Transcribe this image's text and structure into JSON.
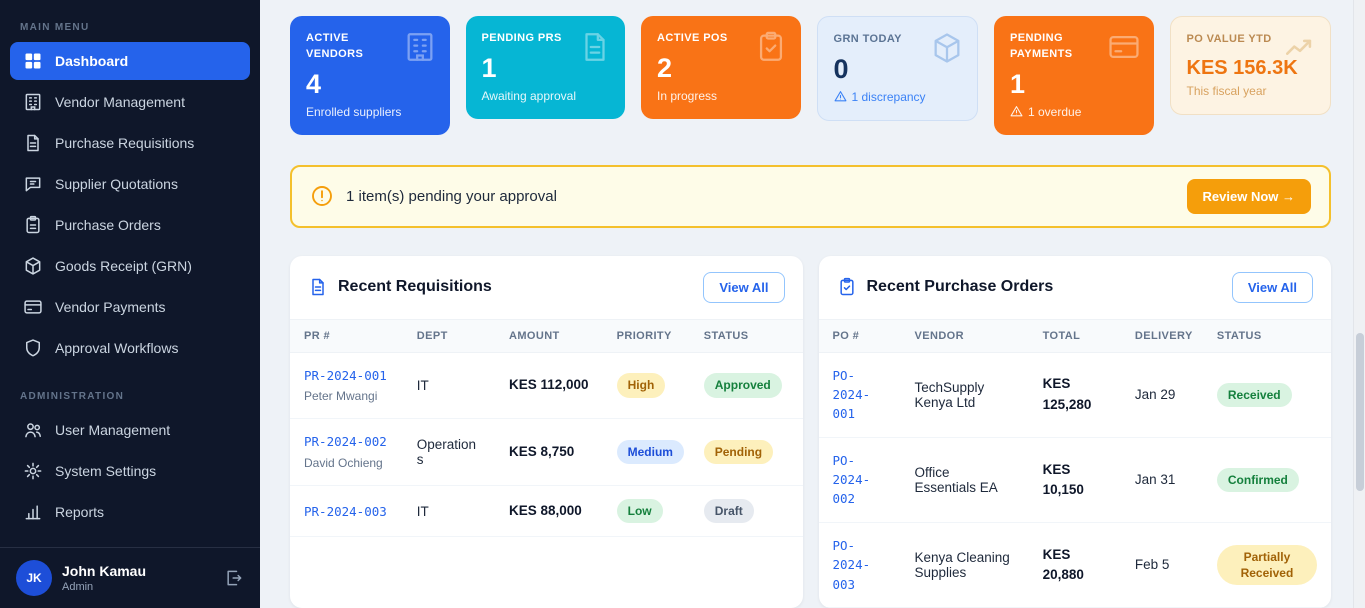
{
  "colors": {
    "accent_blue": "#2563eb",
    "accent_cyan": "#06b6d4",
    "accent_orange": "#f97316",
    "amber": "#f59e0b",
    "sidebar_bg": "#0f172a"
  },
  "sidebar": {
    "main_menu_label": "MAIN MENU",
    "items": [
      {
        "label": "Dashboard",
        "icon": "grid-icon",
        "active": true
      },
      {
        "label": "Vendor Management",
        "icon": "building-icon"
      },
      {
        "label": "Purchase Requisitions",
        "icon": "document-icon"
      },
      {
        "label": "Supplier Quotations",
        "icon": "chat-icon"
      },
      {
        "label": "Purchase Orders",
        "icon": "clipboard-icon"
      },
      {
        "label": "Goods Receipt (GRN)",
        "icon": "box-icon"
      },
      {
        "label": "Vendor Payments",
        "icon": "credit-card-icon"
      },
      {
        "label": "Approval Workflows",
        "icon": "shield-icon"
      }
    ],
    "admin_label": "ADMINISTRATION",
    "admin_items": [
      {
        "label": "User Management",
        "icon": "users-icon"
      },
      {
        "label": "System Settings",
        "icon": "gear-icon"
      },
      {
        "label": "Reports",
        "icon": "bar-chart-icon"
      }
    ],
    "user": {
      "initials": "JK",
      "name": "John Kamau",
      "role": "Admin"
    }
  },
  "stats": [
    {
      "title": "ACTIVE VENDORS",
      "value": "4",
      "subtitle": "Enrolled suppliers",
      "icon": "building-icon",
      "theme": "blue"
    },
    {
      "title": "PENDING PRS",
      "value": "1",
      "subtitle": "Awaiting approval",
      "icon": "document-icon",
      "theme": "cyan"
    },
    {
      "title": "ACTIVE POS",
      "value": "2",
      "subtitle": "In progress",
      "icon": "clipboard-check-icon",
      "theme": "orange"
    },
    {
      "title": "GRN TODAY",
      "value": "0",
      "subtitle": "1 discrepancy",
      "warning": true,
      "icon": "box-icon",
      "theme": "light-blue"
    },
    {
      "title": "PENDING PAYMENTS",
      "value": "1",
      "subtitle": "1 overdue",
      "warning": true,
      "icon": "credit-card-icon",
      "theme": "orange"
    },
    {
      "title": "PO VALUE YTD",
      "value": "KES 156.3K",
      "subtitle": "This fiscal year",
      "icon": "trending-icon",
      "theme": "cream"
    }
  ],
  "alert": {
    "message": "1 item(s) pending your approval",
    "button_label": "Review Now →"
  },
  "requisitions": {
    "title": "Recent Requisitions",
    "view_all_label": "View All",
    "columns": [
      "PR #",
      "DEPT",
      "AMOUNT",
      "PRIORITY",
      "STATUS"
    ],
    "rows": [
      {
        "id": "PR-2024-001",
        "person": "Peter Mwangi",
        "dept": "IT",
        "amount": "KES 112,000",
        "priority": "High",
        "status": "Approved"
      },
      {
        "id": "PR-2024-002",
        "person": "David Ochieng",
        "dept": "Operations",
        "amount": "KES 8,750",
        "priority": "Medium",
        "status": "Pending"
      },
      {
        "id": "PR-2024-003",
        "person": "",
        "dept": "IT",
        "amount": "KES 88,000",
        "priority": "Low",
        "status": "Draft"
      }
    ]
  },
  "purchase_orders": {
    "title": "Recent Purchase Orders",
    "view_all_label": "View All",
    "columns": [
      "PO #",
      "VENDOR",
      "TOTAL",
      "DELIVERY",
      "STATUS"
    ],
    "rows": [
      {
        "id": "PO-2024-001",
        "vendor": "TechSupply Kenya Ltd",
        "total": "KES 125,280",
        "delivery": "Jan 29",
        "status": "Received"
      },
      {
        "id": "PO-2024-002",
        "vendor": "Office Essentials EA",
        "total": "KES 10,150",
        "delivery": "Jan 31",
        "status": "Confirmed"
      },
      {
        "id": "PO-2024-003",
        "vendor": "Kenya Cleaning Supplies",
        "total": "KES 20,880",
        "delivery": "Feb 5",
        "status": "Partially Received"
      }
    ]
  }
}
